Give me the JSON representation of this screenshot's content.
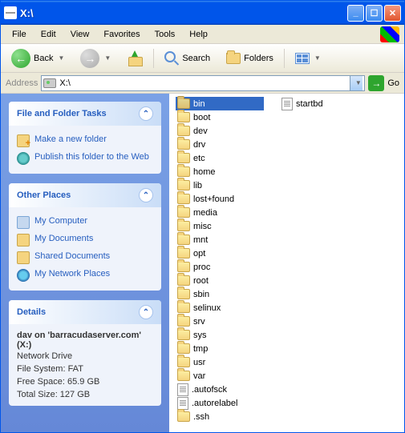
{
  "title": "X:\\",
  "menu": [
    "File",
    "Edit",
    "View",
    "Favorites",
    "Tools",
    "Help"
  ],
  "toolbar": {
    "back": "Back",
    "search": "Search",
    "folders": "Folders"
  },
  "address": {
    "label": "Address",
    "value": "X:\\",
    "go": "Go"
  },
  "panels": {
    "tasks": {
      "title": "File and Folder Tasks",
      "items": [
        {
          "label": "Make a new folder",
          "icon": "ti-newfolder"
        },
        {
          "label": "Publish this folder to the Web",
          "icon": "ti-publish"
        }
      ]
    },
    "places": {
      "title": "Other Places",
      "items": [
        {
          "label": "My Computer",
          "icon": "ti-mycomputer"
        },
        {
          "label": "My Documents",
          "icon": "ti-mydocs"
        },
        {
          "label": "Shared Documents",
          "icon": "ti-shared"
        },
        {
          "label": "My Network Places",
          "icon": "ti-network"
        }
      ]
    },
    "details": {
      "title": "Details",
      "name": "dav on 'barracudaserver.com' (X:)",
      "type": "Network Drive",
      "fs": "File System: FAT",
      "free": "Free Space: 65.9 GB",
      "total": "Total Size: 127 GB"
    }
  },
  "items": [
    {
      "name": "bin",
      "type": "folder",
      "selected": true
    },
    {
      "name": "boot",
      "type": "folder"
    },
    {
      "name": "dev",
      "type": "folder"
    },
    {
      "name": "drv",
      "type": "folder"
    },
    {
      "name": "etc",
      "type": "folder"
    },
    {
      "name": "home",
      "type": "folder"
    },
    {
      "name": "lib",
      "type": "folder"
    },
    {
      "name": "lost+found",
      "type": "folder"
    },
    {
      "name": "media",
      "type": "folder"
    },
    {
      "name": "misc",
      "type": "folder"
    },
    {
      "name": "mnt",
      "type": "folder"
    },
    {
      "name": "opt",
      "type": "folder"
    },
    {
      "name": "proc",
      "type": "folder"
    },
    {
      "name": "root",
      "type": "folder"
    },
    {
      "name": "sbin",
      "type": "folder"
    },
    {
      "name": "selinux",
      "type": "folder"
    },
    {
      "name": "srv",
      "type": "folder"
    },
    {
      "name": "sys",
      "type": "folder"
    },
    {
      "name": "tmp",
      "type": "folder"
    },
    {
      "name": "usr",
      "type": "folder"
    },
    {
      "name": "var",
      "type": "folder"
    },
    {
      "name": ".autofsck",
      "type": "file"
    },
    {
      "name": ".autorelabel",
      "type": "file"
    },
    {
      "name": ".ssh",
      "type": "folder"
    },
    {
      "name": "startbd",
      "type": "file"
    }
  ]
}
